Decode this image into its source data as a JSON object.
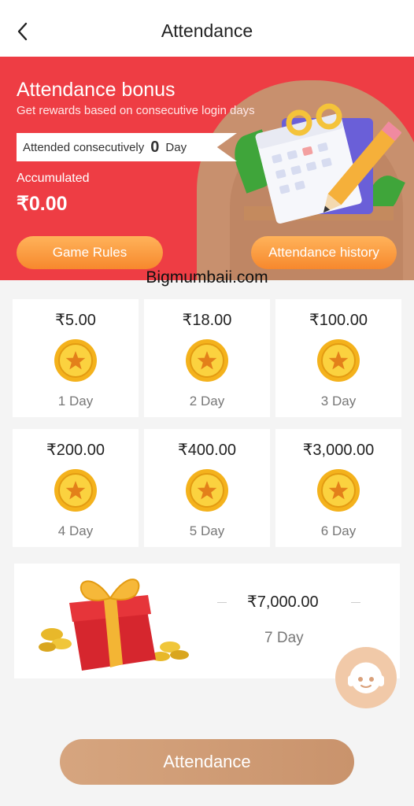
{
  "header": {
    "title": "Attendance",
    "back_icon": "chevron-left-icon"
  },
  "banner": {
    "title": "Attendance bonus",
    "subtitle": "Get rewards based on consecutive login days",
    "consecutive_prefix": "Attended consecutively",
    "consecutive_count": "0",
    "consecutive_suffix": "Day",
    "accumulated_label": "Accumulated",
    "accumulated_value": "₹0.00",
    "rules_button": "Game Rules",
    "history_button": "Attendance history",
    "bg_color": "#ee3d44"
  },
  "watermark": "Bigmumbaii.com",
  "days": [
    {
      "amount": "₹5.00",
      "label": "1 Day"
    },
    {
      "amount": "₹18.00",
      "label": "2 Day"
    },
    {
      "amount": "₹100.00",
      "label": "3 Day"
    },
    {
      "amount": "₹200.00",
      "label": "4 Day"
    },
    {
      "amount": "₹400.00",
      "label": "5 Day"
    },
    {
      "amount": "₹3,000.00",
      "label": "6 Day"
    }
  ],
  "day7": {
    "amount": "₹7,000.00",
    "label": "7 Day"
  },
  "support_icon": "customer-service-icon",
  "attend_button": "Attendance"
}
